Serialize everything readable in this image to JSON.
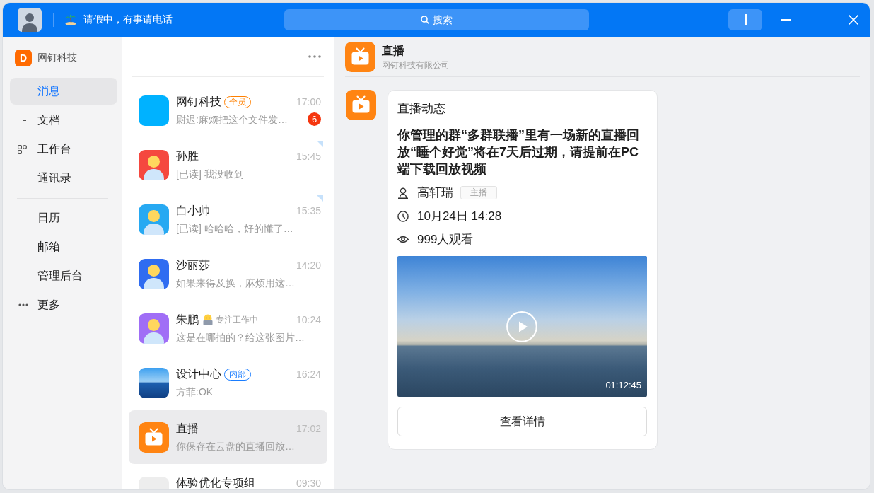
{
  "title_bar": {
    "status": "请假中，有事请电话",
    "search": {
      "placeholder": "搜索"
    }
  },
  "sidebar": {
    "org": {
      "logo": "D",
      "name": "网钉科技"
    },
    "groups": [
      {
        "items": [
          {
            "label": "消息",
            "kind": "plain",
            "selected": true
          },
          {
            "label": "文档",
            "kind": "dash",
            "selected": false
          },
          {
            "label": "工作台",
            "kind": "grid",
            "selected": false
          },
          {
            "label": "通讯录",
            "kind": "plain",
            "selected": false
          }
        ]
      },
      {
        "items": [
          {
            "label": "日历",
            "kind": "plain",
            "selected": false
          },
          {
            "label": "邮箱",
            "kind": "plain",
            "selected": false
          },
          {
            "label": "管理后台",
            "kind": "plain",
            "selected": false
          },
          {
            "label": "更多",
            "kind": "dots",
            "selected": false
          }
        ]
      }
    ]
  },
  "chat_list": {
    "chats": [
      {
        "name": "网钉科技",
        "tag": {
          "label": "全员",
          "color": "#ff8000"
        },
        "time": "17:00",
        "preview": "尉迟:麻烦把这个文件发…",
        "unread": "6",
        "corner_mark": false,
        "selected": false,
        "avatar": {
          "kind": "plain",
          "color": "#00b2ff"
        }
      },
      {
        "name": "孙胜",
        "time": "15:45",
        "preview": "[已读] 我没收到",
        "corner_mark": true,
        "selected": false,
        "avatar": {
          "kind": "cartoon",
          "color": "#f5483f"
        }
      },
      {
        "name": "白小帅",
        "time": "15:35",
        "preview": "[已读] 哈哈哈，好的懂了…",
        "corner_mark": true,
        "selected": false,
        "avatar": {
          "kind": "cartoon",
          "color": "#27a9f2"
        }
      },
      {
        "name": "沙丽莎",
        "time": "14:20",
        "preview": "如果来得及换，麻烦用这…",
        "corner_mark": false,
        "selected": false,
        "avatar": {
          "kind": "cartoon",
          "color": "#2f6cf1"
        }
      },
      {
        "name": "朱鹏",
        "status": "专注工作中",
        "time": "10:24",
        "preview": "这是在哪拍的？给这张图片…",
        "corner_mark": false,
        "selected": false,
        "avatar": {
          "kind": "cartoon",
          "color": "#a06ef6"
        }
      },
      {
        "name": "设计中心",
        "tag": {
          "label": "内部",
          "color": "#1a7dff"
        },
        "time": "16:24",
        "preview": "方菲:OK",
        "corner_mark": false,
        "selected": false,
        "avatar": {
          "kind": "photo"
        }
      },
      {
        "name": "直播",
        "time": "17:02",
        "preview": "你保存在云盘的直播回放…",
        "corner_mark": false,
        "selected": true,
        "avatar": {
          "kind": "live"
        }
      },
      {
        "name": "体验优化专项组",
        "time": "09:30",
        "corner_mark": false,
        "selected": false,
        "avatar": {
          "kind": "plain",
          "color": "#ededed"
        }
      }
    ]
  },
  "conversation": {
    "header": {
      "title": "直播",
      "subtitle": "网钉科技有限公司"
    },
    "message": {
      "title": "直播动态",
      "text": "你管理的群“多群联播”里有一场新的直播回放“睡个好觉”将在7天后过期，请提前在PC端下载回放视频",
      "details": [
        {
          "kind": "host",
          "text": "高轩瑞",
          "tag": "主播"
        },
        {
          "kind": "time",
          "text": "10月24日 14:28"
        },
        {
          "kind": "views",
          "text": "999人观看"
        }
      ],
      "video": {
        "duration": "01:12:45"
      },
      "button": "查看详情"
    }
  }
}
